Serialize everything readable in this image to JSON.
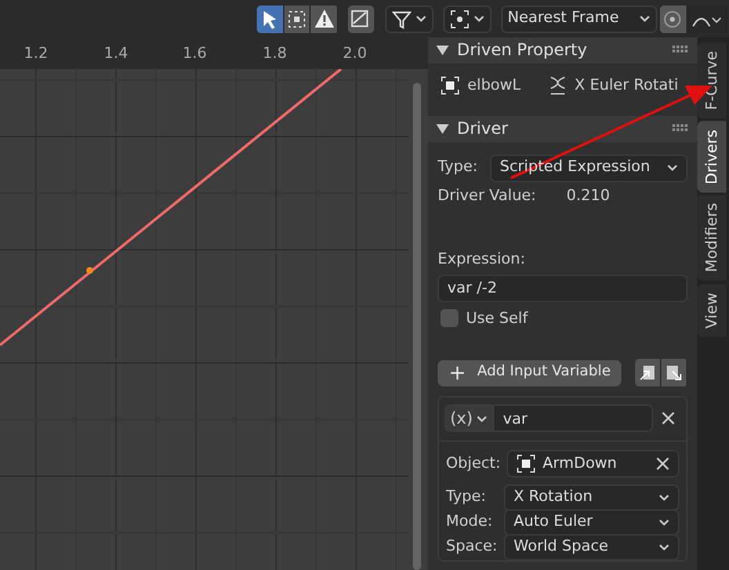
{
  "toolbar": {
    "tools": [
      {
        "kind": "cursor",
        "selected": true
      },
      {
        "kind": "box",
        "selected": false
      },
      {
        "kind": "warning",
        "selected": false
      }
    ],
    "snapping": "Nearest Frame",
    "proportional_editing": {
      "on": false
    }
  },
  "graph": {
    "ruler_labels": [
      "1.2",
      "1.4",
      "1.6",
      "1.8",
      "2.0"
    ]
  },
  "sidebar": {
    "tabs": [
      {
        "label": "F-Curve",
        "selected": false
      },
      {
        "label": "Drivers",
        "selected": true
      },
      {
        "label": "Modifiers",
        "selected": false
      },
      {
        "label": "View",
        "selected": false
      }
    ],
    "driven_property": {
      "title": "Driven Property",
      "expanded": true,
      "object": "elbowL",
      "property": "X Euler Rotati"
    },
    "driver": {
      "title": "Driver",
      "expanded": true,
      "type_label": "Type:",
      "type": "Scripted Expression",
      "value_label": "Driver Value:",
      "value": "0.210",
      "expression_label": "Expression:",
      "expression": "var /-2",
      "use_self": {
        "label": "Use Self",
        "checked": false
      },
      "add_button": "Add Input Variable",
      "add_icon": "+",
      "variable": {
        "type_icon": "(x)",
        "name": "var",
        "object_label": "Object:",
        "object": "ArmDown",
        "fields": [
          {
            "label": "Type:",
            "value": "X Rotation"
          },
          {
            "label": "Mode:",
            "value": "Auto Euler"
          },
          {
            "label": "Space:",
            "value": "World Space"
          }
        ]
      }
    }
  }
}
